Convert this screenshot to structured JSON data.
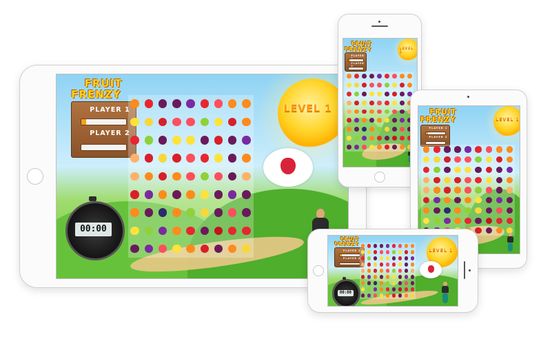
{
  "game": {
    "title_line1": "FRUIT",
    "title_line2": "FRENZY",
    "player1_label": "PLAYER 1",
    "player2_label": "PLAYER 2",
    "player1_progress": 0.1,
    "player2_progress": 0.0,
    "level_label": "LEVEL 1",
    "timer": "00:00",
    "target_fruit_icon": "raspberry-icon"
  },
  "fruit_palette": {
    "orange": "#ff8a1c",
    "plum": "#6a1a5a",
    "grape": "#7a2aa0",
    "strawberry": "#e8262f",
    "watermelon": "#ff4e5c",
    "lemon": "#ffe23a",
    "banana": "#f7d83a",
    "apple_green": "#8fd13a",
    "apple_red": "#d81f2a",
    "cherry": "#c4141e",
    "peach": "#ffb06b",
    "blueberry": "#2b2b6e"
  },
  "fruit_grid_rows": [
    [
      "orange",
      "strawberry",
      "plum",
      "plum",
      "grape",
      "strawberry",
      "watermelon",
      "orange",
      "orange"
    ],
    [
      "lemon",
      "banana",
      "apple_red",
      "watermelon",
      "watermelon",
      "apple_green",
      "lemon",
      "apple_red",
      "orange"
    ],
    [
      "strawberry",
      "apple_green",
      "plum",
      "lemon",
      "lemon",
      "plum",
      "apple_red",
      "plum",
      "grape"
    ],
    [
      "peach",
      "apple_red",
      "banana",
      "apple_red",
      "watermelon",
      "strawberry",
      "lemon",
      "plum",
      "orange"
    ],
    [
      "peach",
      "orange",
      "apple_red",
      "orange",
      "watermelon",
      "apple_green",
      "watermelon",
      "plum",
      "peach"
    ],
    [
      "apple_red",
      "grape",
      "orange",
      "plum",
      "orange",
      "lemon",
      "plum",
      "grape",
      "plum"
    ],
    [
      "orange",
      "plum",
      "blueberry",
      "orange",
      "apple_green",
      "banana",
      "plum",
      "watermelon",
      "plum"
    ],
    [
      "lemon",
      "apple_green",
      "grape",
      "orange",
      "strawberry",
      "plum",
      "cherry",
      "strawberry",
      "strawberry"
    ],
    [
      "plum",
      "grape",
      "watermelon",
      "lemon",
      "orange",
      "apple_red",
      "plum",
      "orange",
      "banana"
    ]
  ]
}
